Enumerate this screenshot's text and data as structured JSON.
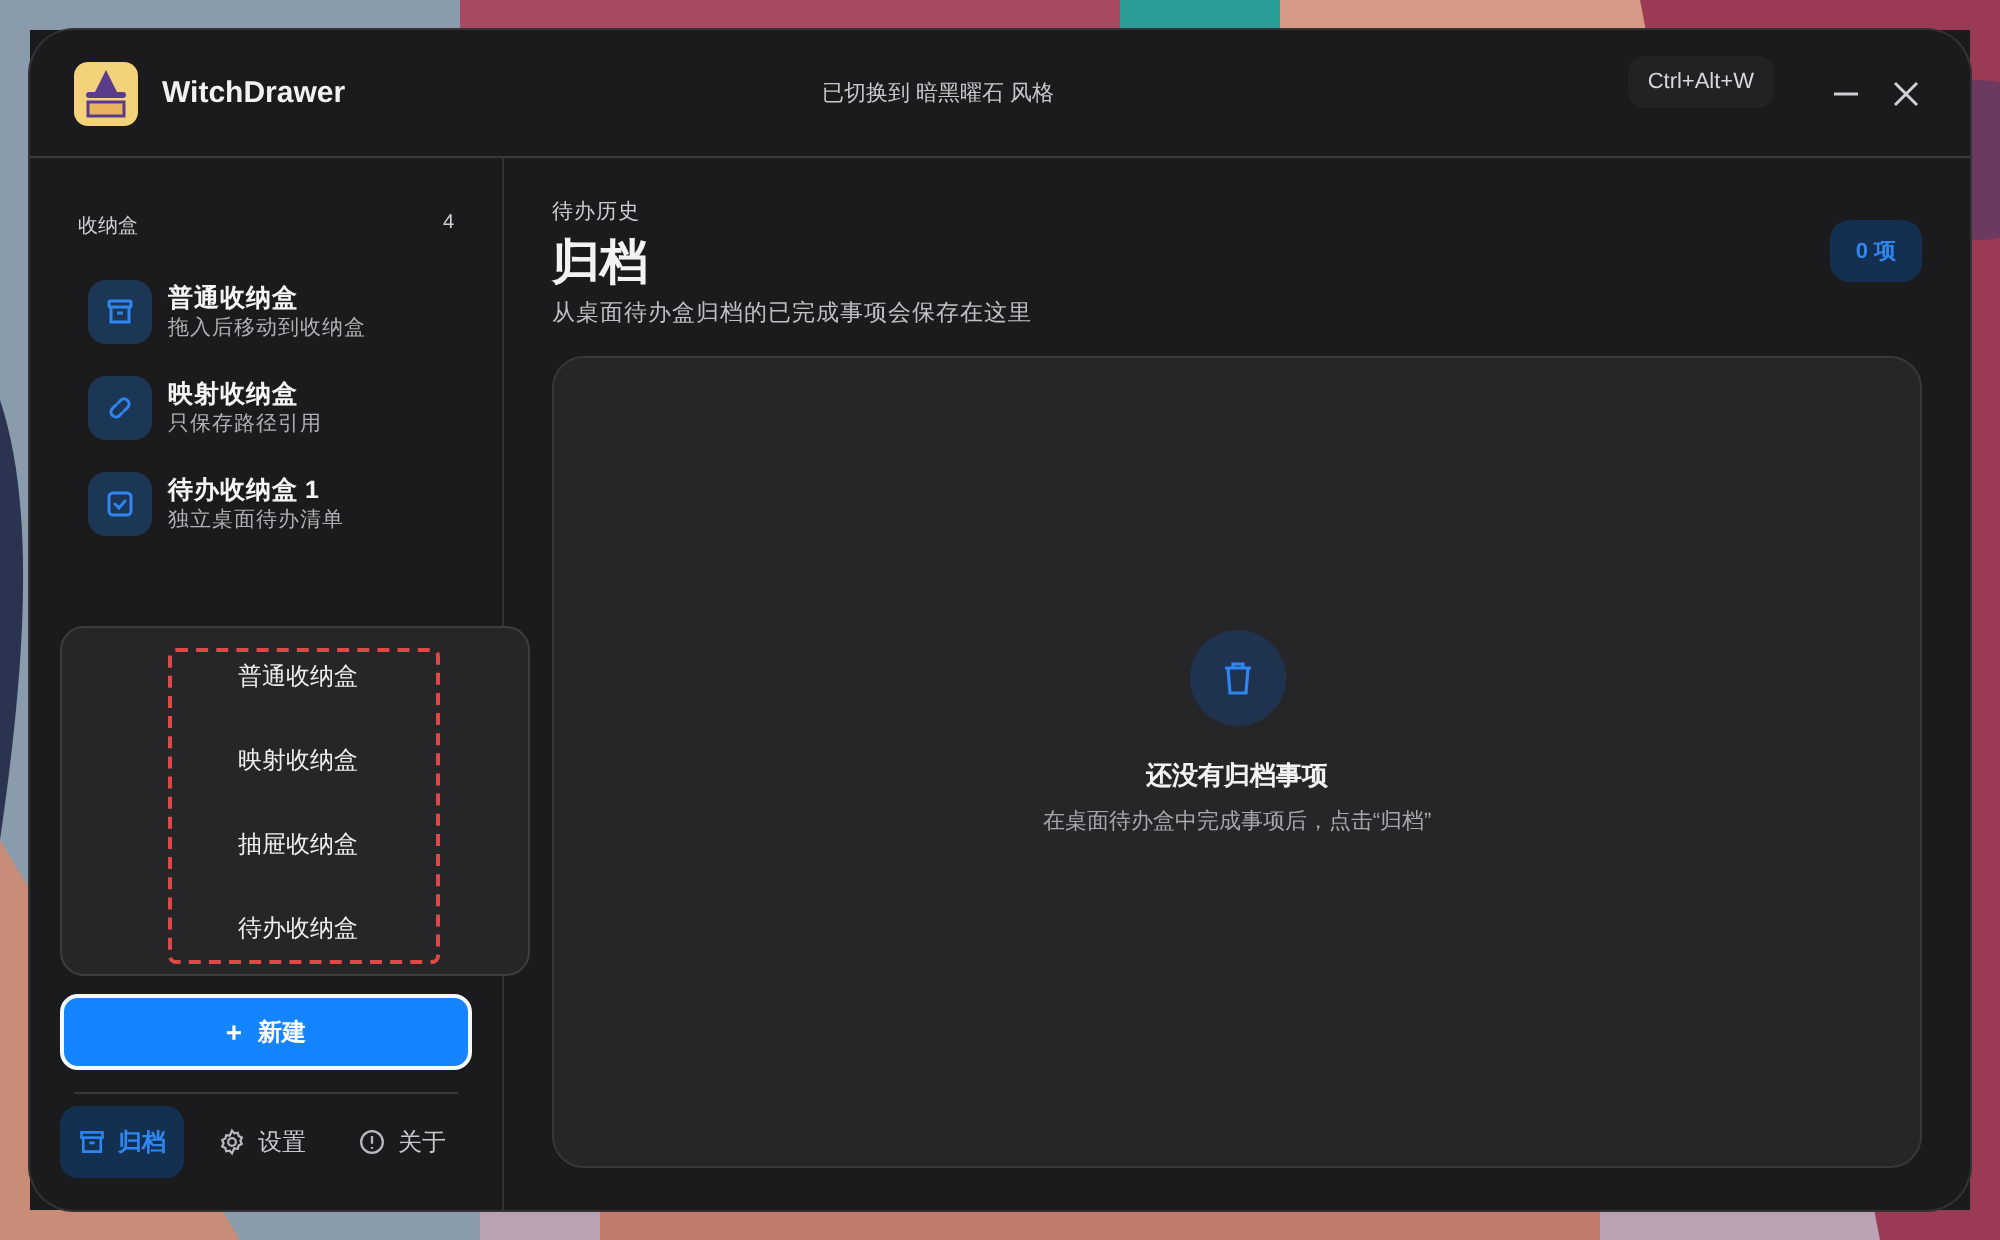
{
  "window": {
    "app_name": "WitchDrawer",
    "status": "已切换到 暗黑曜石 风格",
    "shortcut": "Ctrl+Alt+W"
  },
  "sidebar": {
    "title": "收纳盒",
    "count": "4",
    "items": [
      {
        "kind": "normal",
        "title": "普通收纳盒",
        "subtitle": "拖入后移动到收纳盒"
      },
      {
        "kind": "link",
        "title": "映射收纳盒",
        "subtitle": "只保存路径引用"
      },
      {
        "kind": "todo",
        "title": "待办收纳盒 1",
        "subtitle": "独立桌面待办清单"
      }
    ],
    "new_menu": {
      "items": [
        "普通收纳盒",
        "映射收纳盒",
        "抽屉收纳盒",
        "待办收纳盒"
      ]
    },
    "new_button": {
      "icon": "+",
      "label": "新建"
    },
    "nav": [
      {
        "kind": "archive",
        "label": "归档",
        "selected": true
      },
      {
        "kind": "settings",
        "label": "设置",
        "selected": false
      },
      {
        "kind": "about",
        "label": "关于",
        "selected": false
      }
    ]
  },
  "main": {
    "eyebrow": "待办历史",
    "title": "归档",
    "subtitle": "从桌面待办盒归档的已完成事项会保存在这里",
    "count_badge": "0 项",
    "empty": {
      "title": "还没有归档事项",
      "hint": "在桌面待办盒中完成事项后，点击“归档”"
    }
  }
}
